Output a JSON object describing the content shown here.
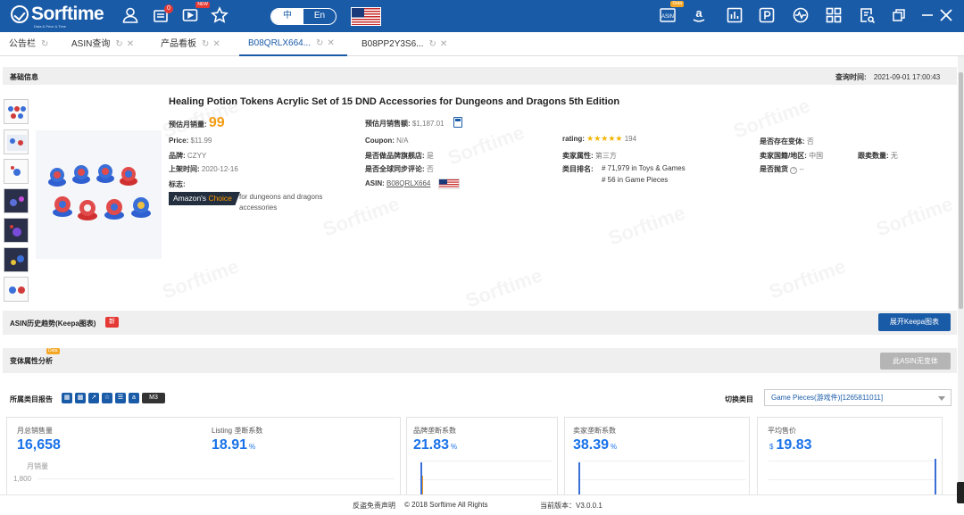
{
  "app": {
    "logo": "Sorftime",
    "logo_sub": "Data & Price & Time",
    "notif_count": "0",
    "new_badge": "NEW",
    "data_badge": "Data",
    "lang_cn": "中",
    "lang_en": "En"
  },
  "tabs": [
    {
      "label": "公告栏"
    },
    {
      "label": "ASIN查询"
    },
    {
      "label": "产品看板"
    },
    {
      "label": "B08QRLX664..."
    },
    {
      "label": "B08PP2Y3S6..."
    }
  ],
  "basic": {
    "section_title": "基础信息",
    "query_time_label": "查询时间:",
    "query_time": "2021-09-01 17:00:43",
    "title": "Healing Potion Tokens Acrylic Set of 15 DND Accessories for Dungeons and Dragons 5th Edition",
    "monthly_sales_label": "预估月销量:",
    "monthly_sales": "99",
    "price_label": "Price:",
    "price": "$11.99",
    "brand_label": "品牌:",
    "brand": "CZYY",
    "launch_label": "上架时间:",
    "launch": "2020-12-16",
    "tag_label": "标志:",
    "ac_amazons": "Amazon's",
    "ac_choice": "Choice",
    "ac_text": "for dungeons and dragons accessories",
    "monthly_revenue_label": "预估月销售额:",
    "monthly_revenue": "$1,187.01",
    "coupon_label": "Coupon:",
    "coupon": "N/A",
    "brand_store_label": "是否做品牌旗舰店:",
    "brand_store": "是",
    "global_review_label": "是否全球同步评论:",
    "global_review": "否",
    "asin_label": "ASIN:",
    "asin": "B08QRLX664",
    "rating_label": "rating:",
    "rating_count": "194",
    "rating_value": 4.5,
    "seller_type_label": "卖家属性:",
    "seller_type": "第三方",
    "rank_label": "类目排名:",
    "rank1": "# 71,979 in Toys & Games",
    "rank2": "# 56 in Game Pieces",
    "variant_label": "是否存在变体:",
    "variant": "否",
    "seller_country_label": "卖家国籍/地区:",
    "seller_country": "中国",
    "follow_label": "跟卖数量:",
    "follow": "无",
    "oos_label": "是否抛货",
    "oos": "--"
  },
  "keepa": {
    "title": "ASIN历史趋势(Keepa图表)",
    "new_tag": "新",
    "button": "展开Keepa图表"
  },
  "variant_section": {
    "title": "变体属性分析",
    "button": "此ASIN无变体"
  },
  "category": {
    "title": "所属类目报告",
    "switch_label": "切换类目",
    "selected": "Game Pieces(游戏件)[1265811011]"
  },
  "cards": [
    {
      "label": "月总销售量",
      "value": "16,658",
      "unit": ""
    },
    {
      "label": "Listing 垄断系数",
      "value": "18.91",
      "unit": "%"
    },
    {
      "label": "品牌垄断系数",
      "value": "21.83",
      "unit": "%"
    },
    {
      "label": "卖家垄断系数",
      "value": "38.39",
      "unit": "%"
    },
    {
      "label": "平均售价",
      "value": "19.83",
      "unit": "$"
    }
  ],
  "chart_axis": {
    "title": "月销量",
    "tick": "1,800"
  },
  "footer": {
    "disclaimer": "反盗免责声明",
    "copyright": "© 2018 Sorftime All Rights",
    "version": "当前版本：V3.0.0.1"
  },
  "watermark": "Sorftime",
  "colors": {
    "brand": "#1a5ba8",
    "accent": "#f39c12",
    "value_blue": "#1a73e8"
  }
}
